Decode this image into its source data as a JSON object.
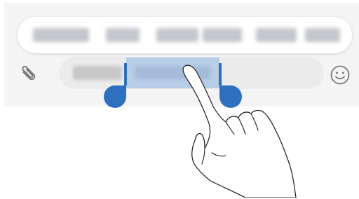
{
  "icons": {
    "attach": "paperclip-icon",
    "emoji": "smiley-icon",
    "gesture": "hand-pointer-icon"
  },
  "colors": {
    "selection": "#b8cde6",
    "handle": "#2f6fc0",
    "input_background": "#ebebeb",
    "panel_background": "#f4f4f4"
  }
}
